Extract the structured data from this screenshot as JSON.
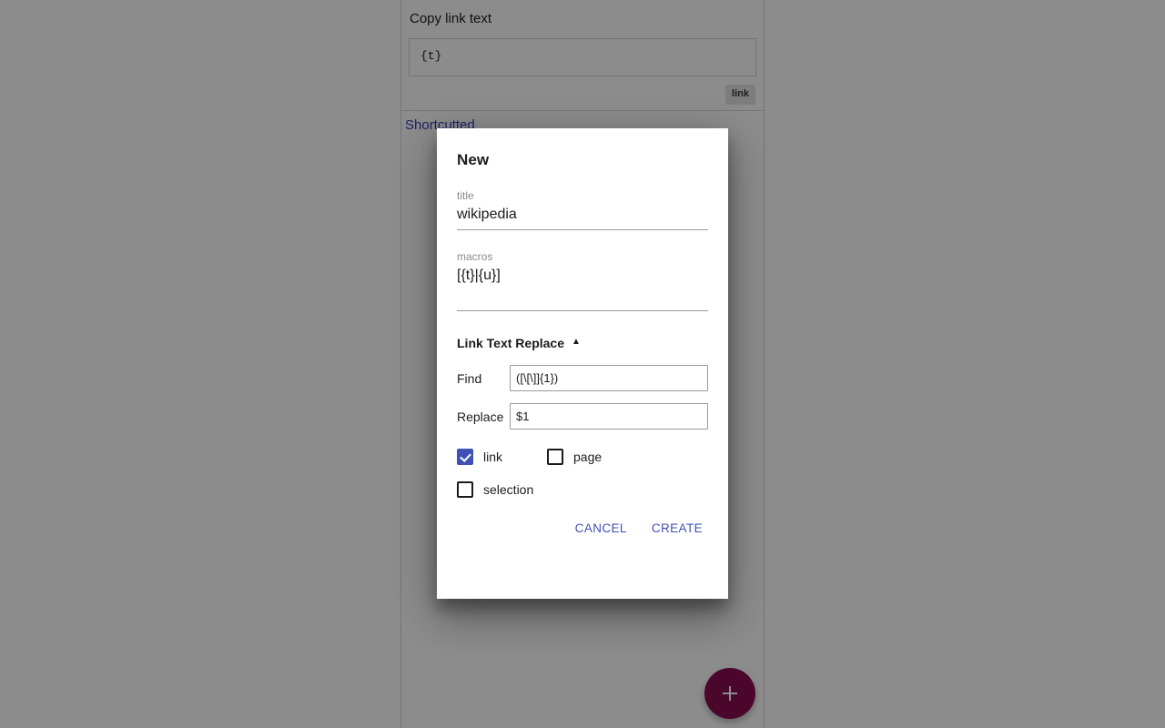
{
  "background": {
    "content_column": {
      "card": {
        "title": "Copy link text",
        "code_value": "{t}",
        "chip_label": "link"
      },
      "link_below": "Shortcutted"
    },
    "fab": {
      "icon": "plus-icon",
      "color": "#880e4f"
    }
  },
  "dialog": {
    "title": "New",
    "fields": [
      {
        "label": "title",
        "value": "wikipedia"
      },
      {
        "label": "macros",
        "value": "[{t}|{u}]"
      }
    ],
    "section": {
      "title": "Link Text Replace",
      "caret": "▲",
      "rows": [
        {
          "label": "Find",
          "value": "([\\[\\]]{1})"
        },
        {
          "label": "Replace",
          "value": "$1"
        }
      ]
    },
    "checkboxes": [
      {
        "label": "link",
        "checked": true
      },
      {
        "label": "page",
        "checked": false
      },
      {
        "label": "selection",
        "checked": false
      }
    ],
    "actions": {
      "cancel": "CANCEL",
      "create": "CREATE"
    },
    "accent_color": "#3f51b5"
  }
}
